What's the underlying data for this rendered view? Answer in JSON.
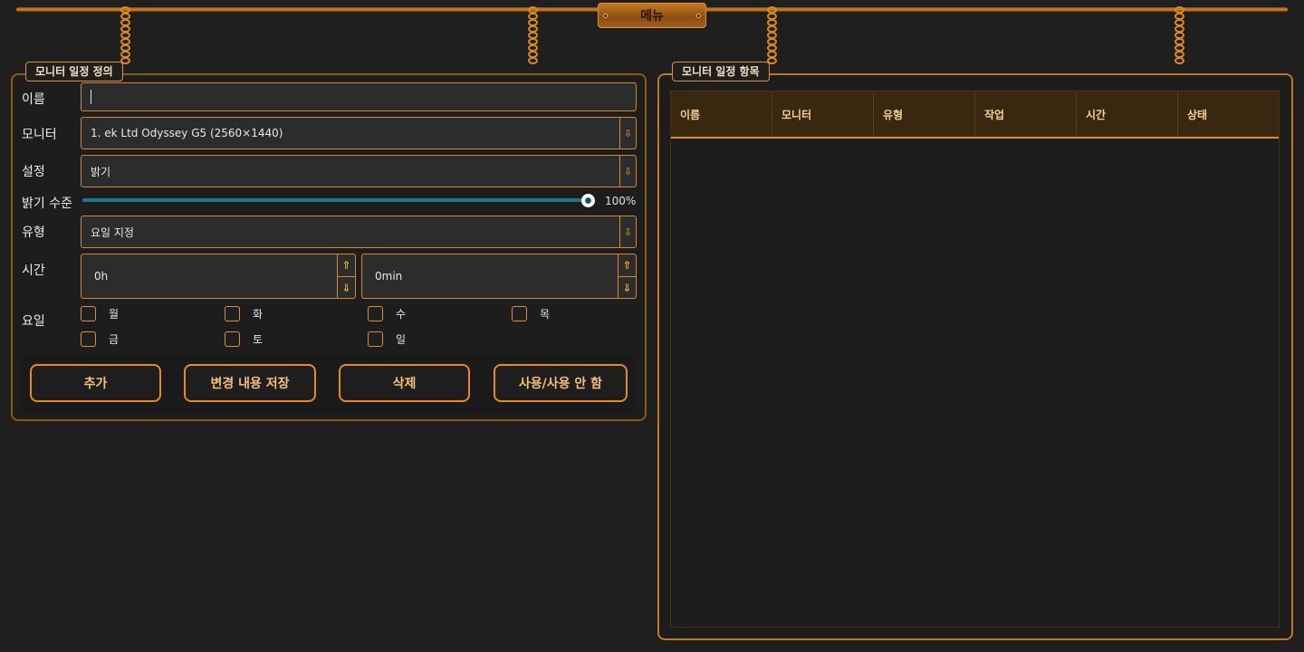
{
  "menu": {
    "label": "메뉴"
  },
  "definition_panel": {
    "title": "모니터 일정 정의",
    "name": {
      "label": "이름",
      "value": ""
    },
    "monitor": {
      "label": "모니터",
      "value": "1. ek Ltd Odyssey G5 (2560×1440)"
    },
    "setting": {
      "label": "설정",
      "value": "밝기"
    },
    "brightness": {
      "label": "밝기 수준",
      "value_text": "100%",
      "value": 100
    },
    "type": {
      "label": "유형",
      "value": "요일 지정"
    },
    "time": {
      "label": "시간",
      "hours": "0h",
      "minutes": "0min"
    },
    "days": {
      "label": "요일",
      "items": [
        "월",
        "화",
        "수",
        "목",
        "금",
        "토",
        "일"
      ]
    },
    "buttons": {
      "add": "추가",
      "save": "변경 내용 저장",
      "delete": "삭제",
      "toggle": "사용/사용 안 함"
    }
  },
  "list_panel": {
    "title": "모니터 일정 항목",
    "columns": [
      "이름",
      "모니터",
      "유형",
      "작업",
      "시간",
      "상태"
    ],
    "rows": []
  },
  "colors": {
    "accent": "#e0902a",
    "background": "#1f1f1f",
    "slider_fill": "#1c7a86"
  },
  "icons": {
    "combo_arrow": "arrow-down-icon",
    "spin_up": "arrow-up-icon",
    "spin_down": "arrow-down-icon"
  }
}
